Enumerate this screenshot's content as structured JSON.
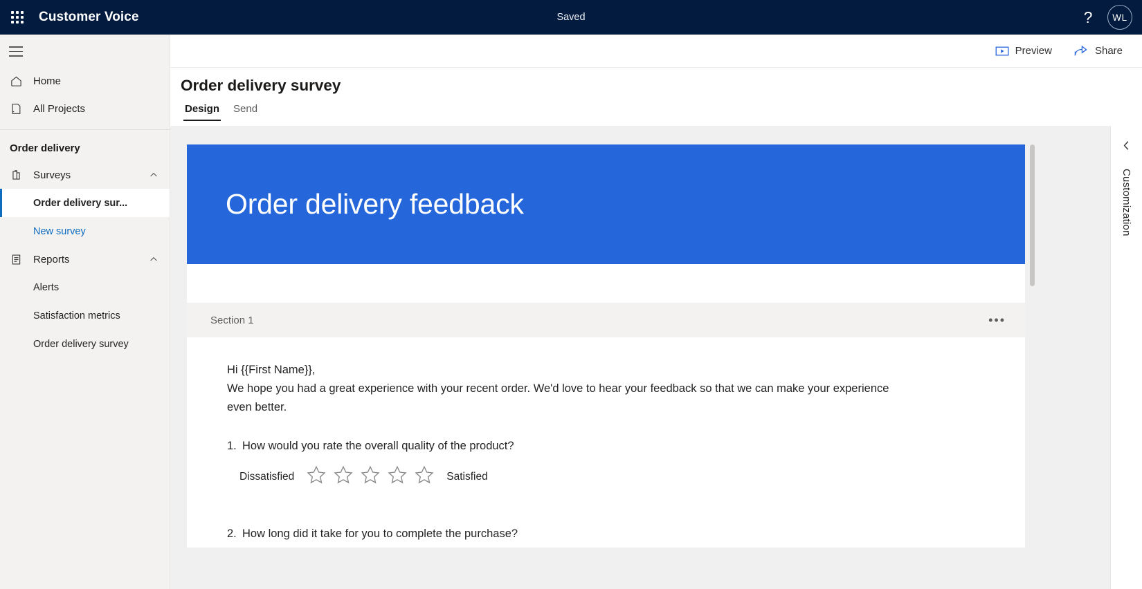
{
  "suite": {
    "app_title": "Customer Voice",
    "save_status": "Saved",
    "help_label": "?",
    "avatar_initials": "WL",
    "waffle_name": "app-launcher"
  },
  "sidebar": {
    "nav": [
      {
        "label": "Home",
        "icon": "home-icon"
      },
      {
        "label": "All Projects",
        "icon": "projects-icon"
      }
    ],
    "project_title": "Order delivery",
    "groups": [
      {
        "label": "Surveys",
        "icon": "surveys-icon",
        "expanded": true,
        "items": [
          {
            "label": "Order delivery sur...",
            "selected": true,
            "link": false
          },
          {
            "label": "New survey",
            "selected": false,
            "link": true
          }
        ]
      },
      {
        "label": "Reports",
        "icon": "reports-icon",
        "expanded": true,
        "items": [
          {
            "label": "Alerts",
            "selected": false,
            "link": false
          },
          {
            "label": "Satisfaction metrics",
            "selected": false,
            "link": false
          },
          {
            "label": "Order delivery survey",
            "selected": false,
            "link": false
          }
        ]
      }
    ]
  },
  "command_bar": {
    "preview_label": "Preview",
    "share_label": "Share"
  },
  "page": {
    "title": "Order delivery survey",
    "tabs": [
      {
        "label": "Design",
        "active": true
      },
      {
        "label": "Send",
        "active": false
      }
    ]
  },
  "form": {
    "banner_title": "Order delivery feedback",
    "banner_color": "#2566db",
    "section_label": "Section 1",
    "section_more_label": "•••",
    "intro_line_1": "Hi {{First Name}},",
    "intro_line_2": "We hope you had a great experience with your recent order. We'd love to hear your feedback so that we can make your experience",
    "intro_line_3": "even better.",
    "questions": [
      {
        "number": "1.",
        "text": "How would you rate the overall quality of the product?",
        "type": "star-rating",
        "low_label": "Dissatisfied",
        "high_label": "Satisfied",
        "star_count": 5,
        "selected_stars": 0
      },
      {
        "number": "2.",
        "text": "How long did it take for you to complete the purchase?",
        "type": "text"
      }
    ]
  },
  "customization": {
    "label": "Customization",
    "collapse_icon": "chevron-left-icon"
  }
}
